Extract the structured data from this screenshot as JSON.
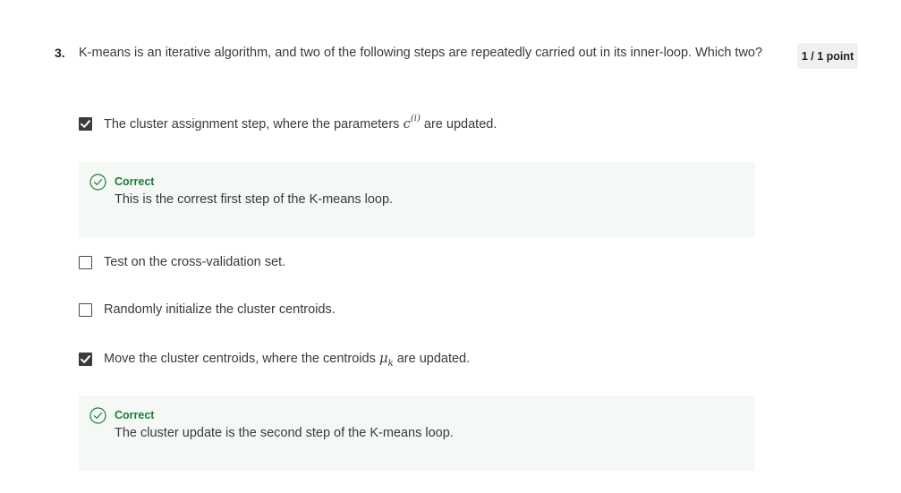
{
  "question": {
    "number": "3.",
    "text": "K-means is an iterative algorithm, and two of the following steps are repeatedly carried out in its inner-loop. Which two?",
    "score": "1 / 1 point"
  },
  "options": [
    {
      "label_before": "The cluster assignment step, where the parameters ",
      "math_base": "c",
      "math_sup": "(i)",
      "label_after": " are updated.",
      "checked": true
    },
    {
      "label": "Test on the cross-validation set.",
      "checked": false
    },
    {
      "label": "Randomly initialize the cluster centroids.",
      "checked": false
    },
    {
      "label_before": "Move the cluster centroids, where the centroids ",
      "math_base": "μ",
      "math_sub": "k",
      "label_after": " are updated.",
      "checked": true
    }
  ],
  "feedback": [
    {
      "title": "Correct",
      "text": "This is the correst first step of the K-means loop."
    },
    {
      "title": "Correct",
      "text": "The cluster update is the second step of the K-means loop."
    }
  ],
  "colors": {
    "correct_green": "#1f7a3a",
    "feedback_bg": "#f4f9f5",
    "checkbox_dark": "#3c3c3c",
    "badge_bg": "#f0f0f0"
  },
  "icons": {
    "check": "checkmark-icon",
    "correct": "check-circle-icon"
  }
}
